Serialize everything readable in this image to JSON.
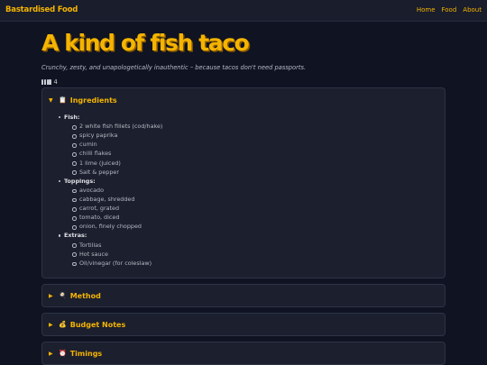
{
  "header": {
    "brand": "Bastardised Food",
    "nav": [
      "Home",
      "Food",
      "About"
    ]
  },
  "recipe": {
    "title": "A kind of fish taco",
    "subtitle": "Crunchy, zesty, and unapologetically inauthentic – because tacos don't need passports.",
    "serves": "4",
    "serves_icon": "people-icon"
  },
  "sections": {
    "ingredients": {
      "label": "Ingredients",
      "icon": "clipboard-icon",
      "emoji": "📋",
      "expanded": true,
      "groups": [
        {
          "label": "Fish:",
          "items": [
            "2 white fish fillets (cod/hake)",
            "spicy paprika",
            "cumin",
            "chilli flakes",
            "1 lime (juiced)",
            "Salt & pepper"
          ]
        },
        {
          "label": "Toppings:",
          "items": [
            "avocado",
            "cabbage, shredded",
            "carrot, grated",
            "tomato, diced",
            "onion, finely chopped"
          ]
        },
        {
          "label": "Extras:",
          "items": [
            "Tortillas",
            "Hot sauce",
            "Oil/vinegar (for coleslaw)"
          ]
        }
      ]
    },
    "method": {
      "label": "Method",
      "icon": "cooking-icon",
      "emoji": "🍳",
      "expanded": false
    },
    "budget": {
      "label": "Budget Notes",
      "icon": "money-bag-icon",
      "emoji": "💰",
      "expanded": false
    },
    "timings": {
      "label": "Timings",
      "icon": "alarm-clock-icon",
      "emoji": "⏰",
      "expanded": false
    }
  },
  "colors": {
    "background": "#0f1322",
    "topbar": "#191d2c",
    "accent": "#f5b400",
    "panel": "#1b1f2e",
    "panel_border": "#2e3346"
  }
}
